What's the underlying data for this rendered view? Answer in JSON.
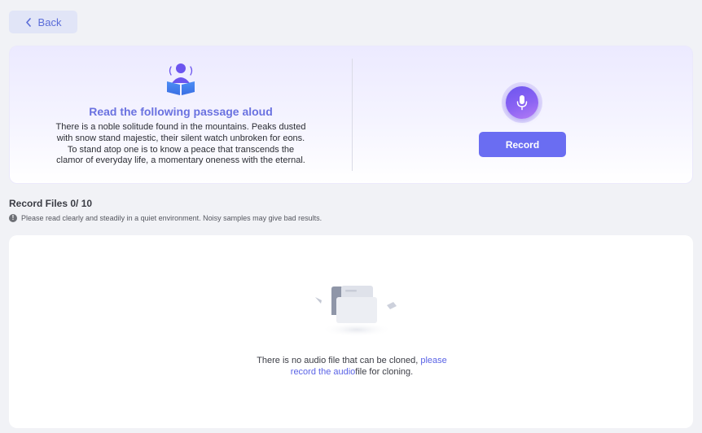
{
  "back": {
    "label": "Back"
  },
  "read_card": {
    "title": "Read the following passage aloud",
    "passage_lines": [
      "There is a noble solitude found in the mountains. Peaks dusted",
      "with snow stand majestic, their silent watch unbroken for eons.",
      "To stand atop one is to know a peace that transcends the",
      "clamor of everyday life, a momentary oneness with the eternal."
    ],
    "record_label": "Record",
    "icons": {
      "reader": "person-reading-book-icon",
      "mic": "microphone-icon"
    }
  },
  "files": {
    "title": "Record Files 0/ 10",
    "tip": "Please read clearly and steadily in a quiet environment. Noisy samples may give bad results.",
    "empty": {
      "text_before": "There is no audio file that can be cloned, ",
      "link_line1": "please",
      "link_line2": "record the audio",
      "text_after": "file for cloning."
    }
  },
  "colors": {
    "accent": "#6a6df2",
    "title_purple": "#6a72e0",
    "link": "#5a63e6",
    "page_bg": "#f1f2f6"
  }
}
